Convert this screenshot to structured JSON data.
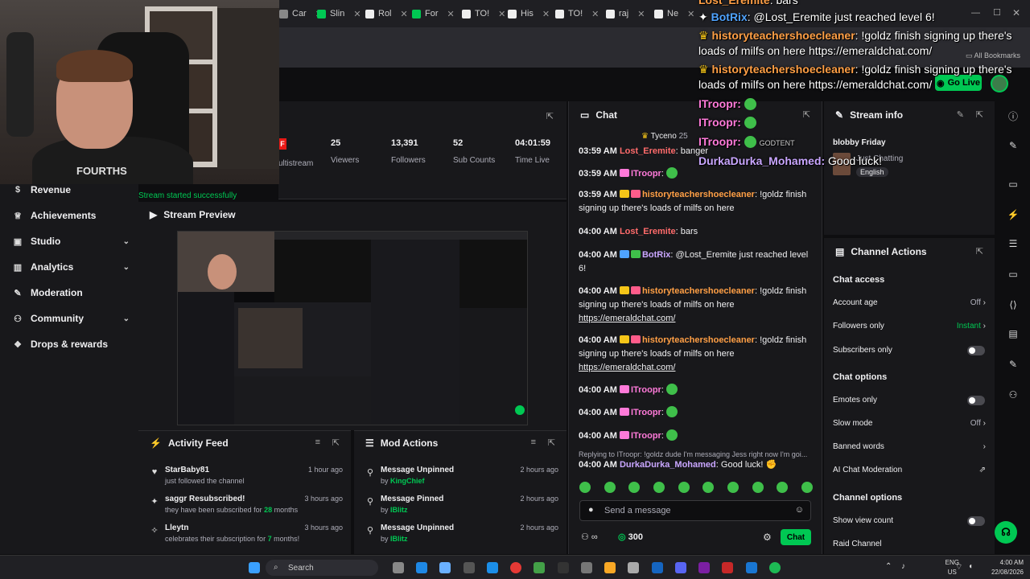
{
  "browser": {
    "tabs": [
      {
        "label": "Car",
        "color": "#888"
      },
      {
        "label": "Slin",
        "color": "#00c853"
      },
      {
        "label": "Rol",
        "color": "#eee"
      },
      {
        "label": "For",
        "color": "#00c853"
      },
      {
        "label": "TO!",
        "color": "#eee"
      },
      {
        "label": "His",
        "color": "#eee"
      },
      {
        "label": "TO!",
        "color": "#eee"
      },
      {
        "label": "raj",
        "color": "#eee"
      },
      {
        "label": "Ne",
        "color": "#eee"
      }
    ],
    "all_bookmarks": "All Bookmarks"
  },
  "go_live": "Go Live",
  "webcam": {
    "shirt_text": "FOURTHS"
  },
  "nav": {
    "items": [
      {
        "label": "Revenue",
        "icon": "revenue-icon",
        "has_chevron": false
      },
      {
        "label": "Achievements",
        "icon": "trophy-icon",
        "has_chevron": false
      },
      {
        "label": "Studio",
        "icon": "studio-icon",
        "has_chevron": true
      },
      {
        "label": "Analytics",
        "icon": "chart-icon",
        "has_chevron": true
      },
      {
        "label": "Moderation",
        "icon": "wrench-icon",
        "has_chevron": false
      },
      {
        "label": "Community",
        "icon": "community-icon",
        "has_chevron": true
      },
      {
        "label": "Drops & rewards",
        "icon": "gift-icon",
        "has_chevron": false
      }
    ]
  },
  "stats": {
    "badge": "F",
    "multistream_label": "ultistream",
    "items": [
      {
        "value": "25",
        "label": "Viewers"
      },
      {
        "value": "13,391",
        "label": "Followers"
      },
      {
        "value": "52",
        "label": "Sub Counts"
      },
      {
        "value": "04:01:59",
        "label": "Time Live"
      }
    ],
    "started": "Stream started successfully"
  },
  "preview": {
    "title": "Stream Preview"
  },
  "activity": {
    "title": "Activity Feed",
    "items": [
      {
        "icon": "heart-icon",
        "name": "StarBaby81",
        "desc_pre": "just followed the channel",
        "hl": "",
        "desc_post": "",
        "time": "1 hour ago"
      },
      {
        "icon": "star-icon",
        "name": "saggr Resubscribed!",
        "desc_pre": "they have been subscribed for ",
        "hl": "28",
        "desc_post": " months",
        "time": "3 hours ago"
      },
      {
        "icon": "party-icon",
        "name": "Lleytn",
        "desc_pre": "celebrates their subscription for ",
        "hl": "7",
        "desc_post": " months!",
        "time": "3 hours ago"
      }
    ]
  },
  "mod_actions": {
    "title": "Mod Actions",
    "items": [
      {
        "action": "Message Unpinned",
        "by_label": "by ",
        "by": "KingChief",
        "time": "2 hours ago"
      },
      {
        "action": "Message Pinned",
        "by_label": "by ",
        "by": "IBlitz",
        "time": "2 hours ago"
      },
      {
        "action": "Message Unpinned",
        "by_label": "by ",
        "by": "IBlitz",
        "time": "2 hours ago"
      }
    ]
  },
  "chat": {
    "title": "Chat",
    "pinned_user": "Tyceno",
    "pinned_count": "25",
    "messages": [
      {
        "ts": "03:59 AM",
        "user": "Lost_Eremite",
        "cls": "u-red",
        "text": "banger",
        "emote": false,
        "link": ""
      },
      {
        "ts": "03:59 AM",
        "user": "ITroopr",
        "cls": "u-pink",
        "text": "",
        "emote": true,
        "link": ""
      },
      {
        "ts": "03:59 AM",
        "user": "historyteachershoecleaner",
        "cls": "u-orange",
        "text": "!goldz finish signing up there's loads of milfs on here",
        "emote": false,
        "link": ""
      },
      {
        "ts": "04:00 AM",
        "user": "Lost_Eremite",
        "cls": "u-red",
        "text": "bars",
        "emote": false,
        "link": ""
      },
      {
        "ts": "04:00 AM",
        "user": "BotRix",
        "cls": "u-lilac",
        "text": "@Lost_Eremite just reached level 6!",
        "emote": false,
        "link": ""
      },
      {
        "ts": "04:00 AM",
        "user": "historyteachershoecleaner",
        "cls": "u-orange",
        "text": "!goldz finish signing up there's loads of milfs on here",
        "emote": false,
        "link": "https://emeraldchat.com/"
      },
      {
        "ts": "04:00 AM",
        "user": "historyteachershoecleaner",
        "cls": "u-orange",
        "text": "!goldz finish signing up there's loads of milfs on here",
        "emote": false,
        "link": "https://emeraldchat.com/"
      },
      {
        "ts": "04:00 AM",
        "user": "ITroopr",
        "cls": "u-pink",
        "text": "",
        "emote": true,
        "link": ""
      },
      {
        "ts": "04:00 AM",
        "user": "ITroopr",
        "cls": "u-pink",
        "text": "",
        "emote": true,
        "link": ""
      },
      {
        "ts": "04:00 AM",
        "user": "ITroopr",
        "cls": "u-pink",
        "text": "",
        "emote": true,
        "link": ""
      }
    ],
    "reply_context": "Replying to ITroopr: !goldz dude I'm messaging Jess right now I'm goi...",
    "last_ts": "04:00 AM",
    "last_user": "DurkaDurka_Mohamed",
    "last_text": "Good luck! ✊",
    "input_placeholder": "Send a message",
    "points": "300",
    "send_label": "Chat"
  },
  "stream_info": {
    "title": "Stream info",
    "stream_title": "blobby Friday",
    "category": "Just Chatting",
    "language": "English"
  },
  "channel_actions": {
    "title": "Channel Actions",
    "chat_access_heading": "Chat access",
    "account_age": {
      "label": "Account age",
      "value": "Off"
    },
    "followers_only": {
      "label": "Followers only",
      "value": "Instant"
    },
    "subscribers_only": {
      "label": "Subscribers only"
    },
    "chat_options_heading": "Chat options",
    "emotes_only": {
      "label": "Emotes only"
    },
    "slow_mode": {
      "label": "Slow mode",
      "value": "Off"
    },
    "banned_words": {
      "label": "Banned words"
    },
    "ai_moderation": {
      "label": "AI Chat Moderation"
    },
    "channel_options_heading": "Channel options",
    "show_view_count": {
      "label": "Show view count"
    },
    "raid_channel": {
      "label": "Raid Channel"
    }
  },
  "overlay": {
    "line0": "bars",
    "line0_user": "Lost_Eremite",
    "line1_user": "BotRix",
    "line1_text": "@Lost_Eremite just reached level 6!",
    "line2_user": "historyteachershoecleaner",
    "line2_text": "!goldz finish signing up there's",
    "line3_text": "loads of milfs on here https://emeraldchat.com/",
    "line4_user": "historyteachershoecleaner",
    "line4_text": "!goldz finish signing up there's",
    "line5_text": "loads of milfs on here https://emeraldchat.com/",
    "troopr": "ITroopr:",
    "last_user": "DurkaDurka_Mohamed:",
    "last_text": "Good luck!",
    "ghost_label": "GODTENT"
  },
  "taskbar": {
    "search": "Search",
    "lang_top": "ENG",
    "lang_bottom": "US",
    "time": "4:00 AM",
    "date": "22/08/2026"
  }
}
